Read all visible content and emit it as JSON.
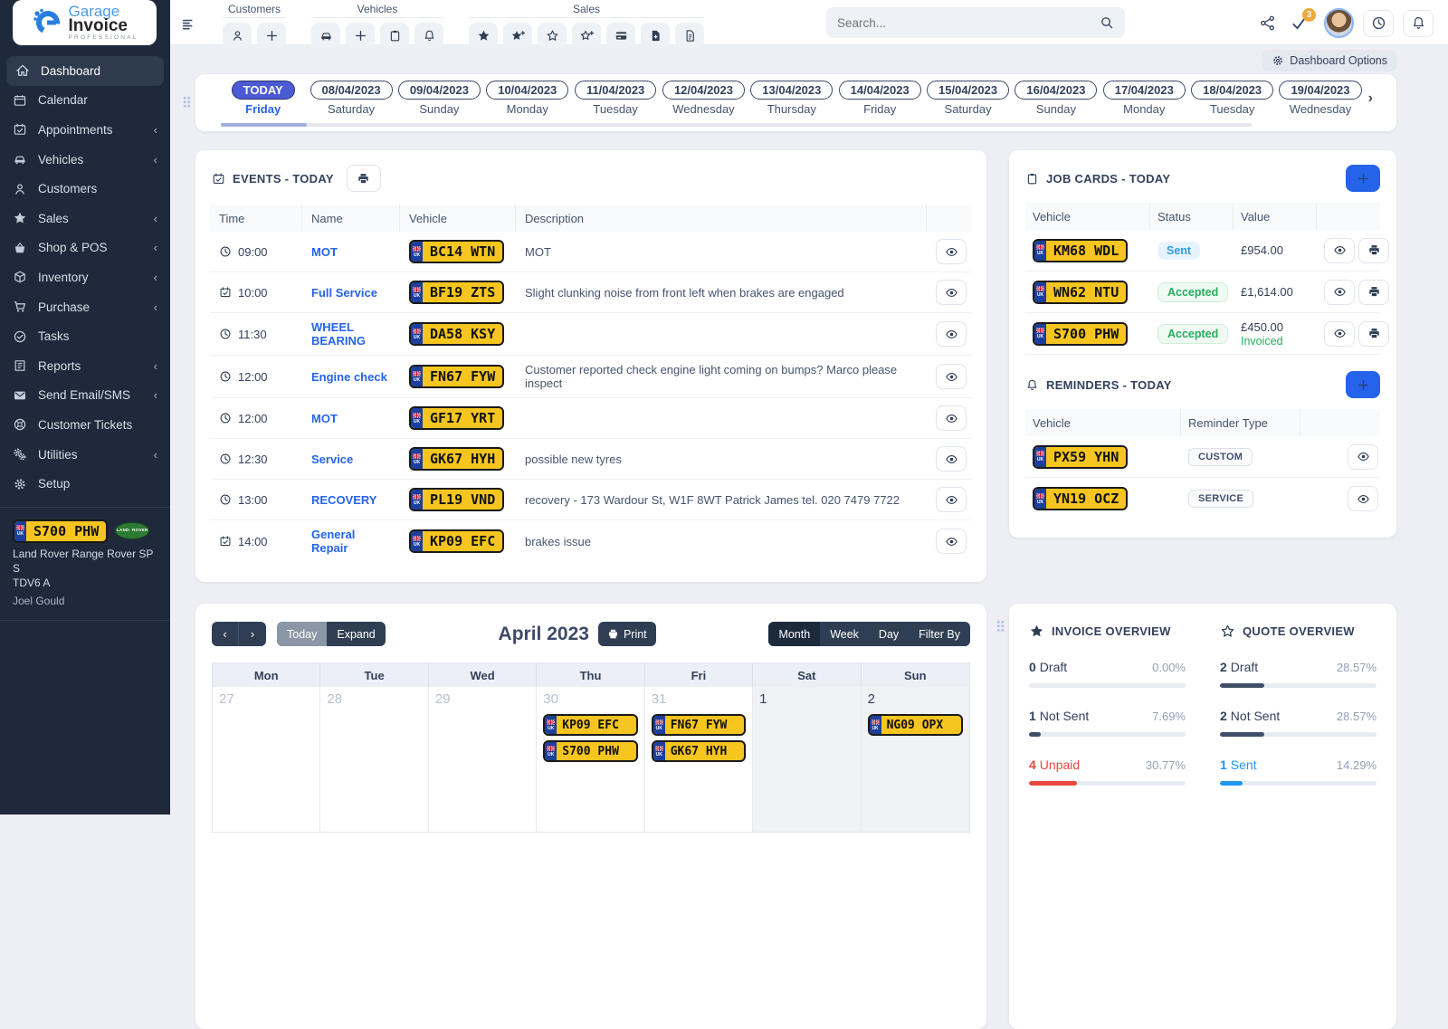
{
  "brand": {
    "name_top": "Garage",
    "name_bottom": "Invoice",
    "subtitle": "PROFESSIONAL"
  },
  "sidebar": {
    "items": [
      {
        "label": "Dashboard",
        "icon": "house-icon",
        "chevron": false,
        "active": true
      },
      {
        "label": "Calendar",
        "icon": "calendar-icon",
        "chevron": false
      },
      {
        "label": "Appointments",
        "icon": "calendar-check-icon",
        "chevron": true
      },
      {
        "label": "Vehicles",
        "icon": "car-icon",
        "chevron": true
      },
      {
        "label": "Customers",
        "icon": "person-icon",
        "chevron": false
      },
      {
        "label": "Sales",
        "icon": "star-icon",
        "chevron": true
      },
      {
        "label": "Shop & POS",
        "icon": "basket-icon",
        "chevron": true
      },
      {
        "label": "Inventory",
        "icon": "box-icon",
        "chevron": true
      },
      {
        "label": "Purchase",
        "icon": "cart-icon",
        "chevron": true
      },
      {
        "label": "Tasks",
        "icon": "check-circle-icon",
        "chevron": false
      },
      {
        "label": "Reports",
        "icon": "report-icon",
        "chevron": true
      },
      {
        "label": "Send Email/SMS",
        "icon": "mail-icon",
        "chevron": true
      },
      {
        "label": "Customer Tickets",
        "icon": "ticket-icon",
        "chevron": false
      },
      {
        "label": "Utilities",
        "icon": "gears-icon",
        "chevron": true
      },
      {
        "label": "Setup",
        "icon": "gear-icon",
        "chevron": false
      }
    ],
    "vehicle_card": {
      "plate": "S700 PHW",
      "brand_badge": "LAND- ROVER",
      "line1": "Land Rover Range Rover SP S",
      "line2": "TDV6 A",
      "owner": "Joel Gould"
    }
  },
  "topbar": {
    "groups": [
      {
        "label": "Customers",
        "icons": [
          "person-icon",
          "plus-icon"
        ]
      },
      {
        "label": "Vehicles",
        "icons": [
          "car-icon",
          "plus-icon",
          "clipboard-icon",
          "bell-icon"
        ]
      },
      {
        "label": "Sales",
        "icons": [
          "star-filled-icon",
          "star-plus-filled-icon",
          "star-outline-icon",
          "star-plus-outline-icon",
          "credit-card-icon",
          "file-plus-icon",
          "file-icon"
        ]
      }
    ],
    "search_placeholder": "Search...",
    "notification_badge": "3"
  },
  "dashboard_options_label": "Dashboard Options",
  "dates": {
    "items": [
      {
        "date": "TODAY",
        "day": "Friday",
        "active": true
      },
      {
        "date": "08/04/2023",
        "day": "Saturday"
      },
      {
        "date": "09/04/2023",
        "day": "Sunday"
      },
      {
        "date": "10/04/2023",
        "day": "Monday"
      },
      {
        "date": "11/04/2023",
        "day": "Tuesday"
      },
      {
        "date": "12/04/2023",
        "day": "Wednesday"
      },
      {
        "date": "13/04/2023",
        "day": "Thursday"
      },
      {
        "date": "14/04/2023",
        "day": "Friday"
      },
      {
        "date": "15/04/2023",
        "day": "Saturday"
      },
      {
        "date": "16/04/2023",
        "day": "Sunday"
      },
      {
        "date": "17/04/2023",
        "day": "Monday"
      },
      {
        "date": "18/04/2023",
        "day": "Tuesday"
      },
      {
        "date": "19/04/2023",
        "day": "Wednesday"
      }
    ]
  },
  "events": {
    "title": "EVENTS - TODAY",
    "columns": {
      "time": "Time",
      "name": "Name",
      "vehicle": "Vehicle",
      "description": "Description"
    },
    "rows": [
      {
        "time": "09:00",
        "name": "MOT",
        "plate": "BC14 WTN",
        "description": "MOT"
      },
      {
        "time": "10:00",
        "name": "Full Service",
        "plate": "BF19 ZTS",
        "description": "Slight clunking noise from front left when brakes are engaged"
      },
      {
        "time": "11:30",
        "name": "WHEEL BEARING",
        "plate": "DA58 KSY",
        "description": ""
      },
      {
        "time": "12:00",
        "name": "Engine check",
        "plate": "FN67 FYW",
        "description": "Customer reported check engine light coming on bumps? Marco please inspect"
      },
      {
        "time": "12:00",
        "name": "MOT",
        "plate": "GF17 YRT",
        "description": ""
      },
      {
        "time": "12:30",
        "name": "Service",
        "plate": "GK67 HYH",
        "description": "possible new tyres"
      },
      {
        "time": "13:00",
        "name": "RECOVERY",
        "plate": "PL19 VND",
        "description": "recovery - 173 Wardour St, W1F 8WT Patrick James tel. 020 7479 7722"
      },
      {
        "time": "14:00",
        "name": "General Repair",
        "plate": "KP09 EFC",
        "description": "brakes issue"
      }
    ]
  },
  "job_cards": {
    "title": "JOB CARDS - TODAY",
    "columns": {
      "vehicle": "Vehicle",
      "status": "Status",
      "value": "Value"
    },
    "rows": [
      {
        "plate": "KM68 WDL",
        "status": "Sent",
        "value": "£954.00",
        "value_note": ""
      },
      {
        "plate": "WN62 NTU",
        "status": "Accepted",
        "value": "£1,614.00",
        "value_note": ""
      },
      {
        "plate": "S700 PHW",
        "status": "Accepted",
        "value": "£450.00",
        "value_note": "Invoiced"
      }
    ]
  },
  "reminders": {
    "title": "REMINDERS - TODAY",
    "columns": {
      "vehicle": "Vehicle",
      "type": "Reminder Type"
    },
    "rows": [
      {
        "plate": "PX59 YHN",
        "type": "CUSTOM"
      },
      {
        "plate": "YN19 OCZ",
        "type": "SERVICE"
      }
    ]
  },
  "calendar": {
    "title": "April 2023",
    "today_label": "Today",
    "expand_label": "Expand",
    "print_label": "Print",
    "views": [
      "Month",
      "Week",
      "Day",
      "Filter By"
    ],
    "active_view": "Month",
    "day_headers": [
      "Mon",
      "Tue",
      "Wed",
      "Thu",
      "Fri",
      "Sat",
      "Sun"
    ],
    "cells": [
      {
        "day": "27",
        "plates": []
      },
      {
        "day": "28",
        "plates": []
      },
      {
        "day": "29",
        "plates": []
      },
      {
        "day": "30",
        "plates": [
          "KP09 EFC",
          "S700 PHW"
        ]
      },
      {
        "day": "31",
        "plates": [
          "FN67 FYW",
          "GK67 HYH"
        ]
      },
      {
        "day": "1",
        "plates": []
      },
      {
        "day": "2",
        "plates": [
          "NG09 OPX"
        ]
      }
    ]
  },
  "overviews": [
    {
      "title": "INVOICE OVERVIEW",
      "rows": [
        {
          "count": "0",
          "label": "Draft",
          "pct": "0.00%",
          "bar": 0,
          "color": "dark"
        },
        {
          "count": "1",
          "label": "Not Sent",
          "pct": "7.69%",
          "bar": 7.69,
          "color": "dark"
        },
        {
          "count": "4",
          "label": "Unpaid",
          "pct": "30.77%",
          "bar": 30.77,
          "color": "red"
        }
      ]
    },
    {
      "title": "QUOTE OVERVIEW",
      "rows": [
        {
          "count": "2",
          "label": "Draft",
          "pct": "28.57%",
          "bar": 28.57,
          "color": "dark"
        },
        {
          "count": "2",
          "label": "Not Sent",
          "pct": "28.57%",
          "bar": 28.57,
          "color": "dark"
        },
        {
          "count": "1",
          "label": "Sent",
          "pct": "14.29%",
          "bar": 14.29,
          "color": "blue"
        }
      ]
    }
  ]
}
